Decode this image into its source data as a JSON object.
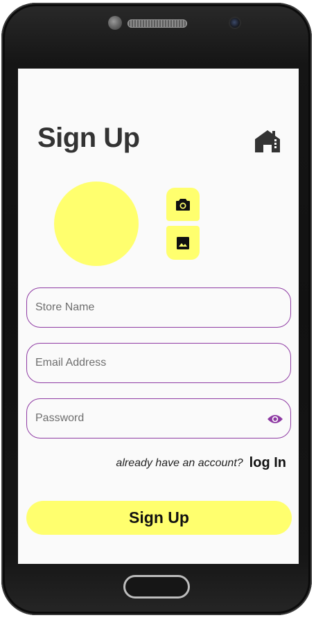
{
  "header": {
    "title": "Sign Up",
    "store_icon": "store-icon"
  },
  "profile": {
    "avatar_color": "#ffff6e",
    "camera_icon": "camera-icon",
    "gallery_icon": "image-icon"
  },
  "form": {
    "store_name": {
      "value": "",
      "placeholder": "Store Name"
    },
    "email": {
      "value": "",
      "placeholder": "Email Address"
    },
    "password": {
      "value": "",
      "placeholder": "Password",
      "toggle_icon": "eye-icon"
    }
  },
  "login": {
    "prompt": "already have an account?",
    "link_label": "log In"
  },
  "submit": {
    "label": "Sign Up"
  },
  "colors": {
    "accent_yellow": "#ffff6e",
    "border_purple": "#8e3aa3",
    "screen_bg": "#fafafa",
    "title_text": "#333333"
  }
}
